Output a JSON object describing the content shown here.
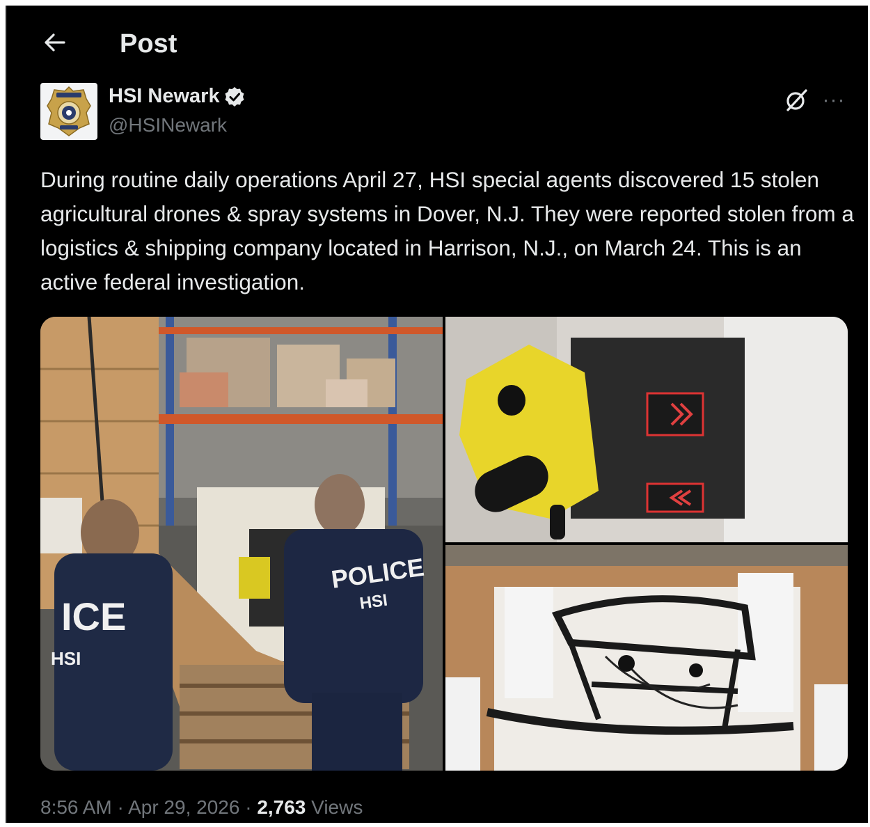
{
  "header": {
    "back_icon": "arrow-left-icon",
    "title": "Post"
  },
  "author": {
    "avatar_icon": "hsi-badge-logo",
    "display_name": "HSI Newark",
    "verified_icon": "verified-badge-icon",
    "handle": "@HSINewark"
  },
  "actions": {
    "grok_icon": "grok-icon",
    "more_icon": "more-horizontal-icon",
    "more_label": "···"
  },
  "post": {
    "text": "During routine daily operations April 27, HSI special agents discovered 15 stolen agricultural drones & spray systems in Dover, N.J. They were reported stolen from a logistics & shipping company located in Harrison, N.J., on March 24. This is an active federal investigation."
  },
  "media": {
    "photo_1": {
      "jacket_text_1": "POLICE",
      "jacket_text_2": "HSI",
      "jacket_text_3": "ICE",
      "jacket_text_4": "HSI"
    },
    "photo_2": {},
    "photo_3": {}
  },
  "meta": {
    "time": "8:56 AM",
    "separator": " · ",
    "date": "Apr 29, 2026",
    "views_count": "2,763",
    "views_label": " Views"
  },
  "colors": {
    "background": "#000000",
    "text_primary": "#e7e9ea",
    "text_secondary": "#71767b",
    "verified": "#e7e9ea"
  }
}
